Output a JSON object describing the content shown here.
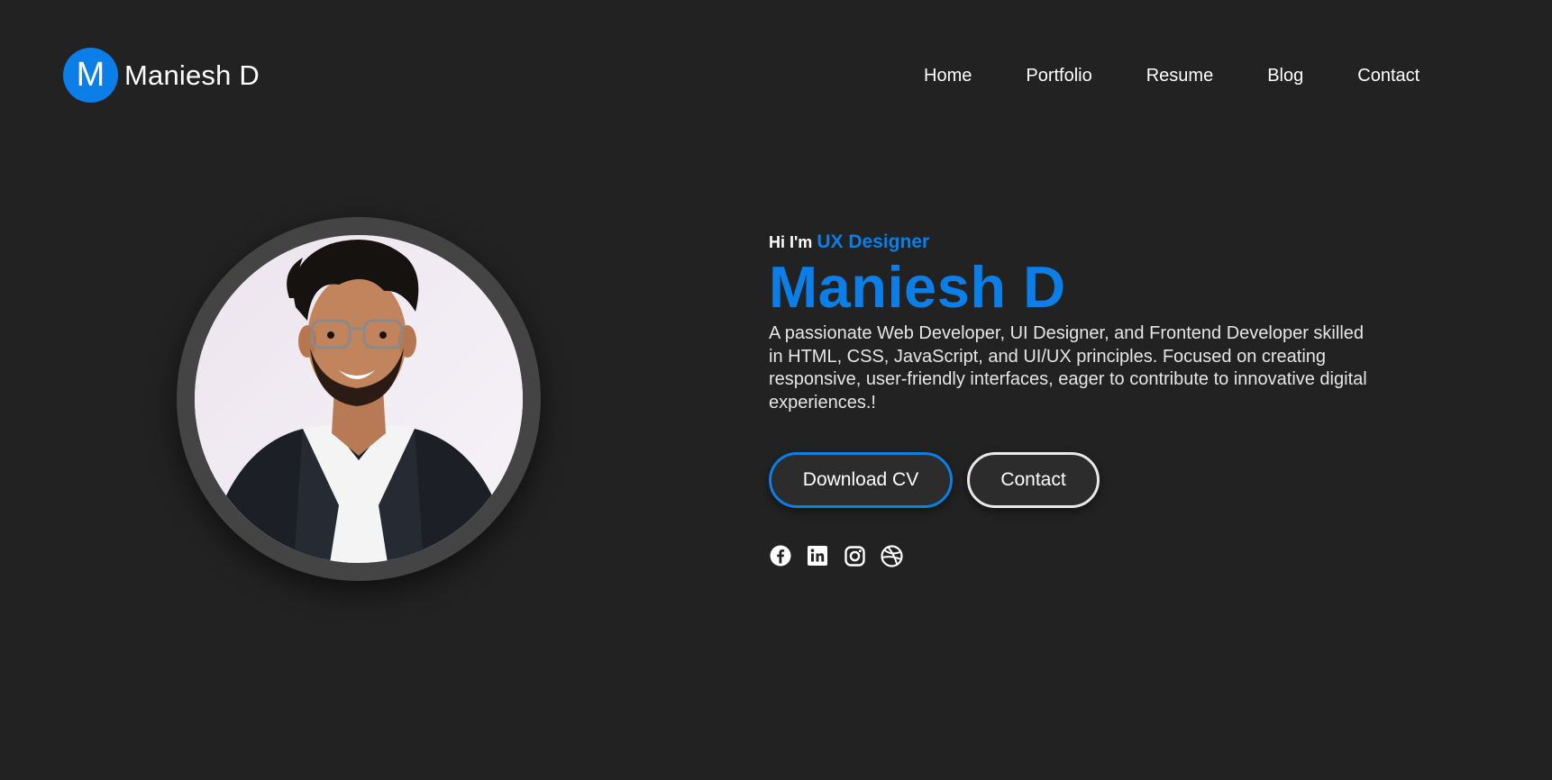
{
  "header": {
    "logo_letter": "M",
    "brand_name": "Maniesh D",
    "nav": [
      {
        "label": "Home"
      },
      {
        "label": "Portfolio"
      },
      {
        "label": "Resume"
      },
      {
        "label": "Blog"
      },
      {
        "label": "Contact"
      }
    ]
  },
  "hero": {
    "greeting": "Hi I'm",
    "role": "UX Designer",
    "name": "Maniesh D",
    "bio": "A passionate Web Developer, UI Designer, and Frontend Developer skilled in HTML, CSS, JavaScript, and UI/UX principles. Focused on creating responsive, user-friendly interfaces, eager to contribute to innovative digital experiences.!",
    "buttons": {
      "primary_label": "Download CV",
      "secondary_label": "Contact"
    },
    "socials": [
      {
        "icon": "facebook-icon"
      },
      {
        "icon": "linkedin-icon"
      },
      {
        "icon": "instagram-icon"
      },
      {
        "icon": "dribbble-icon"
      }
    ]
  },
  "theme": {
    "background": "#222222",
    "accent": "#0b7ee8",
    "text": "#ffffff"
  }
}
